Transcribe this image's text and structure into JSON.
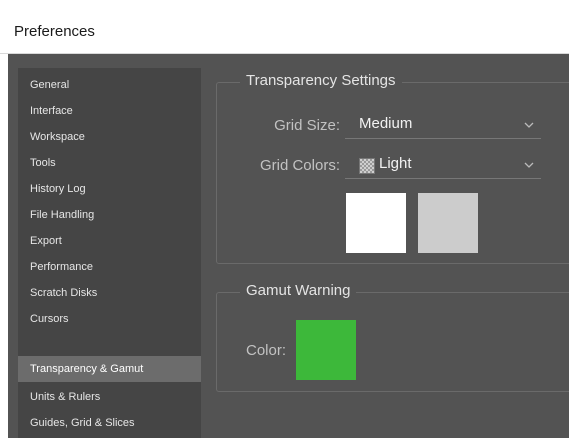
{
  "window": {
    "title": "Preferences"
  },
  "sidebar": {
    "items": [
      {
        "label": "General"
      },
      {
        "label": "Interface"
      },
      {
        "label": "Workspace"
      },
      {
        "label": "Tools"
      },
      {
        "label": "History Log"
      },
      {
        "label": "File Handling"
      },
      {
        "label": "Export"
      },
      {
        "label": "Performance"
      },
      {
        "label": "Scratch Disks"
      },
      {
        "label": "Cursors"
      },
      {
        "label": "Transparency & Gamut"
      },
      {
        "label": "Units & Rulers"
      },
      {
        "label": "Guides, Grid & Slices"
      }
    ],
    "selected": "Transparency & Gamut"
  },
  "transparency": {
    "title": "Transparency Settings",
    "grid_size_label": "Grid Size:",
    "grid_size_value": "Medium",
    "grid_colors_label": "Grid Colors:",
    "grid_colors_value": "Light",
    "swatch1_color": "#ffffff",
    "swatch2_color": "#cccccc"
  },
  "gamut": {
    "title": "Gamut Warning",
    "color_label": "Color:",
    "color_value": "#3db83a"
  },
  "colors": {
    "panel_bg": "#535353",
    "sidebar_bg": "#454545",
    "selected_bg": "#6c6c6c"
  }
}
